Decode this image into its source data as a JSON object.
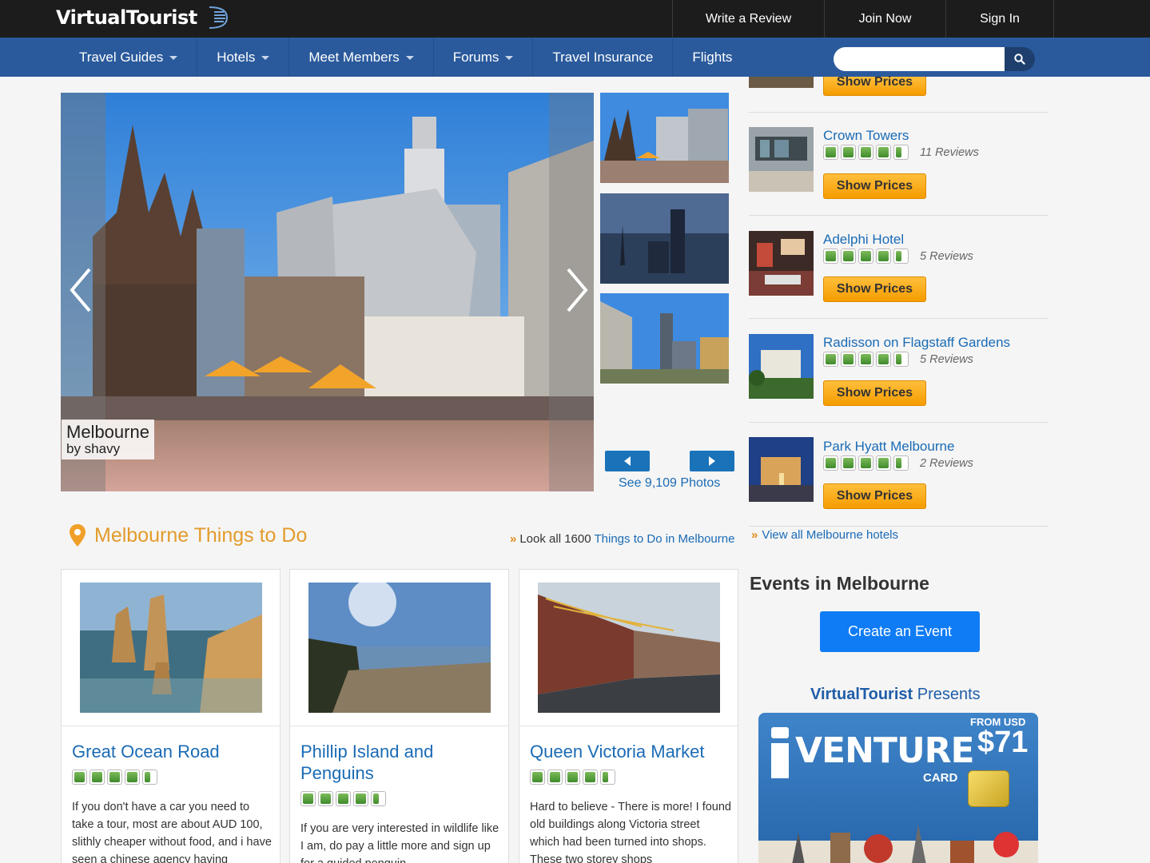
{
  "header": {
    "logo_text": "VirtualTourist",
    "links": [
      {
        "label": "Write a Review"
      },
      {
        "label": "Join Now"
      },
      {
        "label": "Sign In"
      }
    ]
  },
  "nav": {
    "items": [
      {
        "label": "Travel Guides",
        "dropdown": true
      },
      {
        "label": "Hotels",
        "dropdown": true
      },
      {
        "label": "Meet Members",
        "dropdown": true
      },
      {
        "label": "Forums",
        "dropdown": true
      },
      {
        "label": "Travel Insurance",
        "dropdown": false
      },
      {
        "label": "Flights",
        "dropdown": false
      }
    ],
    "search": {
      "placeholder": "",
      "value": "",
      "icon": "search-icon"
    }
  },
  "gallery": {
    "caption_title": "Melbourne",
    "caption_by": "by shavy",
    "see_photos": "See 9,109 Photos"
  },
  "things_to_do": {
    "title": "Melbourne Things to Do",
    "see_all_prefix": "Look all 1600",
    "see_all_link": "Things to Do in Melbourne",
    "cards": [
      {
        "title": "Great Ocean Road",
        "rating": 4.5,
        "text": "If you don't have a car you need to take a tour, most are about AUD 100, slithly cheaper without food, and i have seen a chinese agency having"
      },
      {
        "title": "Phillip Island and Penguins",
        "rating": 4.5,
        "text": "If you are very interested in wildlife like I am, do pay a little more and sign up for a guided penguin"
      },
      {
        "title": "Queen Victoria Market",
        "rating": 4.5,
        "text": "Hard to believe - There is more! I found old buildings along Victoria street which had been turned into shops. These two storey shops"
      }
    ]
  },
  "hotels": {
    "show_prices_label": "Show Prices",
    "items": [
      {
        "name": "Crown Towers",
        "rating": 4.5,
        "reviews": "11 Reviews"
      },
      {
        "name": "Adelphi Hotel",
        "rating": 4.5,
        "reviews": "5 Reviews"
      },
      {
        "name": "Radisson on Flagstaff Gardens",
        "rating": 4.5,
        "reviews": "5 Reviews"
      },
      {
        "name": "Park Hyatt Melbourne",
        "rating": 4.5,
        "reviews": "2 Reviews"
      }
    ],
    "view_all": "View all Melbourne hotels"
  },
  "events": {
    "title": "Events in Melbourne",
    "create_button": "Create an Event"
  },
  "promo": {
    "presents_brand": "VirtualTourist",
    "presents_word": "Presents",
    "card_name": "VENTURE",
    "card_sub": "CARD",
    "from_label": "FROM USD",
    "price": "$71"
  },
  "colors": {
    "topbar": "#1c1c1c",
    "navbar": "#2a5a9c",
    "link": "#1a6bb5",
    "accent_orange": "#e39b2c",
    "show_prices": "#f5a300",
    "create_event": "#0f7cf5"
  }
}
